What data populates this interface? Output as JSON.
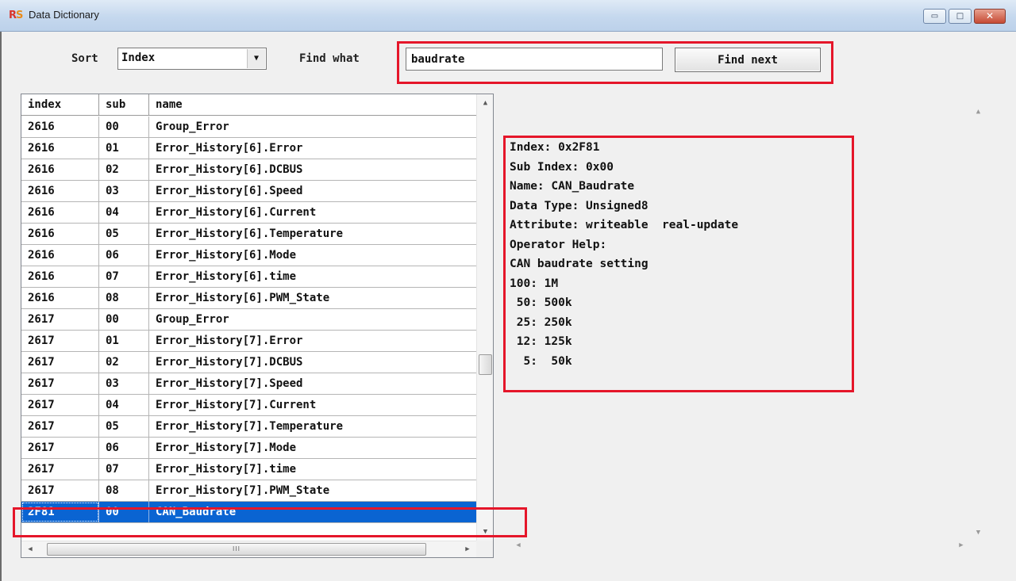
{
  "window": {
    "title": "Data Dictionary",
    "icon_r": "R",
    "icon_s": "S",
    "controls": {
      "minimize": "▭",
      "maximize": "□",
      "close": "✕"
    }
  },
  "toolbar": {
    "sort_label": "Sort",
    "sort_value": "Index",
    "find_label": "Find what",
    "find_value": "baudrate",
    "find_button": "Find next"
  },
  "list": {
    "columns": [
      "index",
      "sub",
      "name"
    ],
    "rows": [
      [
        "2616",
        "00",
        "Group_Error"
      ],
      [
        "2616",
        "01",
        "Error_History[6].Error"
      ],
      [
        "2616",
        "02",
        "Error_History[6].DCBUS"
      ],
      [
        "2616",
        "03",
        "Error_History[6].Speed"
      ],
      [
        "2616",
        "04",
        "Error_History[6].Current"
      ],
      [
        "2616",
        "05",
        "Error_History[6].Temperature"
      ],
      [
        "2616",
        "06",
        "Error_History[6].Mode"
      ],
      [
        "2616",
        "07",
        "Error_History[6].time"
      ],
      [
        "2616",
        "08",
        "Error_History[6].PWM_State"
      ],
      [
        "2617",
        "00",
        "Group_Error"
      ],
      [
        "2617",
        "01",
        "Error_History[7].Error"
      ],
      [
        "2617",
        "02",
        "Error_History[7].DCBUS"
      ],
      [
        "2617",
        "03",
        "Error_History[7].Speed"
      ],
      [
        "2617",
        "04",
        "Error_History[7].Current"
      ],
      [
        "2617",
        "05",
        "Error_History[7].Temperature"
      ],
      [
        "2617",
        "06",
        "Error_History[7].Mode"
      ],
      [
        "2617",
        "07",
        "Error_History[7].time"
      ],
      [
        "2617",
        "08",
        "Error_History[7].PWM_State"
      ],
      [
        "2F81",
        "00",
        "CAN_Baudrate"
      ]
    ],
    "selected_row": 18,
    "scroll_grip": "III"
  },
  "detail": {
    "lines": [
      "Index: 0x2F81",
      "Sub Index: 0x00",
      "Name: CAN_Baudrate",
      "Data Type: Unsigned8",
      "Attribute: writeable  real-update",
      "Operator Help:",
      "CAN baudrate setting",
      "100: 1M",
      " 50: 500k",
      " 25: 250k",
      " 12: 125k",
      "  5:  50k"
    ]
  },
  "colors": {
    "highlight": "#e5162a",
    "selection": "#0a64d2"
  }
}
